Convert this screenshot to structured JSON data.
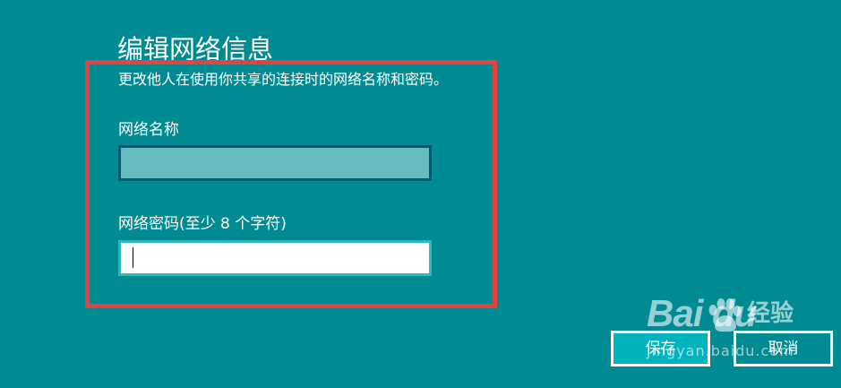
{
  "page": {
    "title": "编辑网络信息",
    "description": "更改他人在使用你共享的连接时的网络名称和密码。"
  },
  "network_name": {
    "label": "网络名称",
    "value": ""
  },
  "network_password": {
    "label": "网络密码(至少 8 个字符)",
    "value": ""
  },
  "buttons": {
    "save_label": "保存",
    "cancel_label": "取消"
  },
  "watermark": {
    "logo": "Bai du",
    "cn": "经验",
    "url": "jingyan.baidu.com"
  },
  "colors": {
    "background": "#008b93",
    "highlight_frame": "#e8423f",
    "name_field_fill": "#67bcc2",
    "save_button_fill": "#00b4be"
  }
}
